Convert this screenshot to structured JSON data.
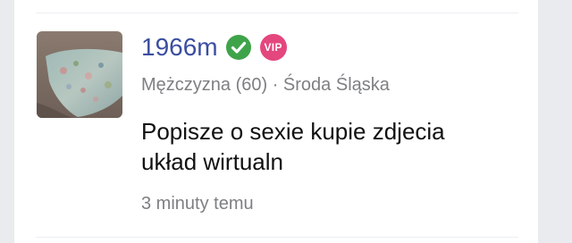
{
  "post": {
    "username": "1966m",
    "verified_icon": "check-circle-icon",
    "verified_color": "#3fa34a",
    "vip_label": "VIP",
    "vip_color": "#e4467e",
    "gender": "Mężczyzna",
    "age": "(60)",
    "separator": "·",
    "city": "Środa Śląska",
    "meta_line": "Mężczyzna (60) · Środa Śląska",
    "message_line_1": "Popisze o sexie kupie zdjecia",
    "message_line_2": "układ wirtualn",
    "time_ago": "3 minuty temu",
    "username_color": "#3b4ea0"
  }
}
